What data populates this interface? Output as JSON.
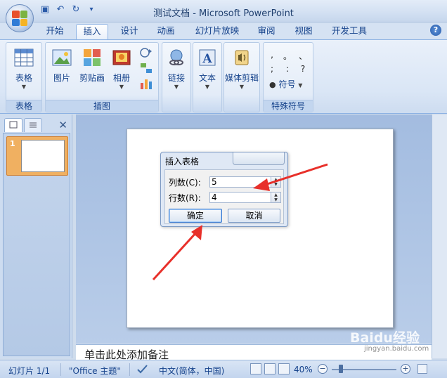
{
  "title": "测试文档 - Microsoft PowerPoint",
  "qat": {
    "icons": [
      "save-icon",
      "undo-icon",
      "redo-icon",
      "customize-icon"
    ]
  },
  "tabs": [
    {
      "label": "开始"
    },
    {
      "label": "插入",
      "active": true
    },
    {
      "label": "设计"
    },
    {
      "label": "动画"
    },
    {
      "label": "幻灯片放映"
    },
    {
      "label": "审阅"
    },
    {
      "label": "视图"
    },
    {
      "label": "开发工具"
    }
  ],
  "ribbon": {
    "groups": {
      "table": {
        "label": "表格",
        "buttons": [
          {
            "label": "表格"
          }
        ]
      },
      "illustrations": {
        "label": "插图",
        "buttons": [
          {
            "label": "图片"
          },
          {
            "label": "剪贴画"
          },
          {
            "label": "相册"
          }
        ]
      },
      "links": {
        "buttons": [
          {
            "label": "链接"
          }
        ]
      },
      "text": {
        "buttons": [
          {
            "label": "文本"
          }
        ]
      },
      "media": {
        "buttons": [
          {
            "label": "媒体剪辑"
          }
        ]
      },
      "symbols": {
        "label": "特殊符号",
        "buttons": [
          {
            "label": "符号"
          }
        ],
        "chars": [
          ",",
          "。",
          "、",
          ";",
          ":",
          "?"
        ]
      }
    }
  },
  "slide_panel": {
    "thumb_number": "1"
  },
  "dialog": {
    "title": "插入表格",
    "columns_label": "列数(C):",
    "columns_value": "5",
    "rows_label": "行数(R):",
    "rows_value": "4",
    "ok_label": "确定",
    "cancel_label": "取消"
  },
  "notes_placeholder": "单击此处添加备注",
  "statusbar": {
    "slide": "幻灯片 1/1",
    "theme": "\"Office 主题\"",
    "language": "中文(简体，中国)",
    "zoom": "40%"
  },
  "watermark": {
    "text": "Baidu经验",
    "url": "jingyan.baidu.com"
  },
  "colors": {
    "ribbon_text": "#15428b",
    "arrow": "#e8302a",
    "thumb_selected": "#f0b061"
  }
}
